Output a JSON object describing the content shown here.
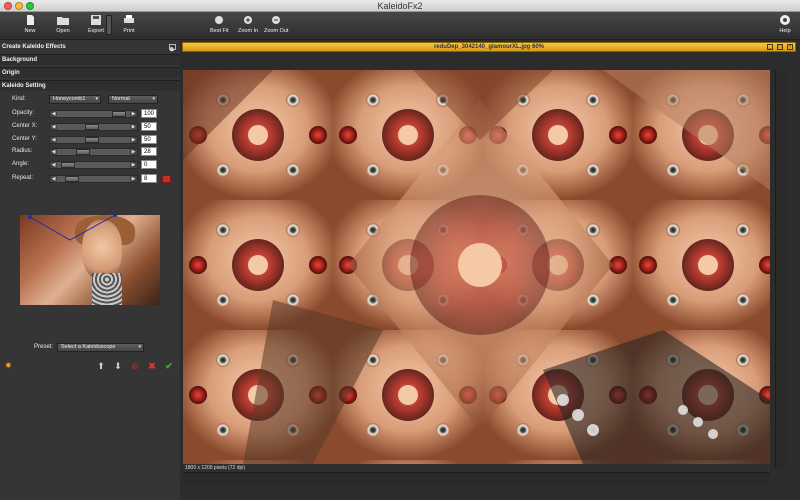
{
  "window": {
    "title": "KaleidoFx2"
  },
  "toolbar": {
    "new": "New",
    "open": "Open",
    "export": "Export",
    "print": "Print",
    "best_fit": "Best Fit",
    "zoom_in": "Zoom In",
    "zoom_out": "Zoom Out",
    "help": "Help"
  },
  "panel": {
    "title": "Create Kaleido Effects",
    "sections": {
      "background": "Background",
      "origin": "Origin",
      "kaleido": "Kaleido Setting"
    },
    "kind": {
      "label": "Kind:",
      "value": "Honeycomb1"
    },
    "blend": {
      "value": "Normal"
    },
    "params": [
      {
        "label": "Opacity:",
        "value": "100",
        "fraction": 0.92
      },
      {
        "label": "Center X:",
        "value": "50",
        "fraction": 0.45
      },
      {
        "label": "Center Y:",
        "value": "50",
        "fraction": 0.45
      },
      {
        "label": "Radius:",
        "value": "28",
        "fraction": 0.3
      },
      {
        "label": "Angle:",
        "value": "0",
        "fraction": 0.05
      },
      {
        "label": "Repeat:",
        "value": "8",
        "fraction": 0.12
      }
    ],
    "preset": {
      "label": "Preset:",
      "value": "Select a Kaleidoscope"
    }
  },
  "document": {
    "title": "reduDep_3042140_glamourXL.jpg 60%",
    "status": "1800 x 1200 pixels (72 dpi)"
  },
  "colors": {
    "doc_title": "#f0b733",
    "accent_red": "#c3302a",
    "accept_green": "#3fae2a",
    "gear": "#f39b1f"
  }
}
